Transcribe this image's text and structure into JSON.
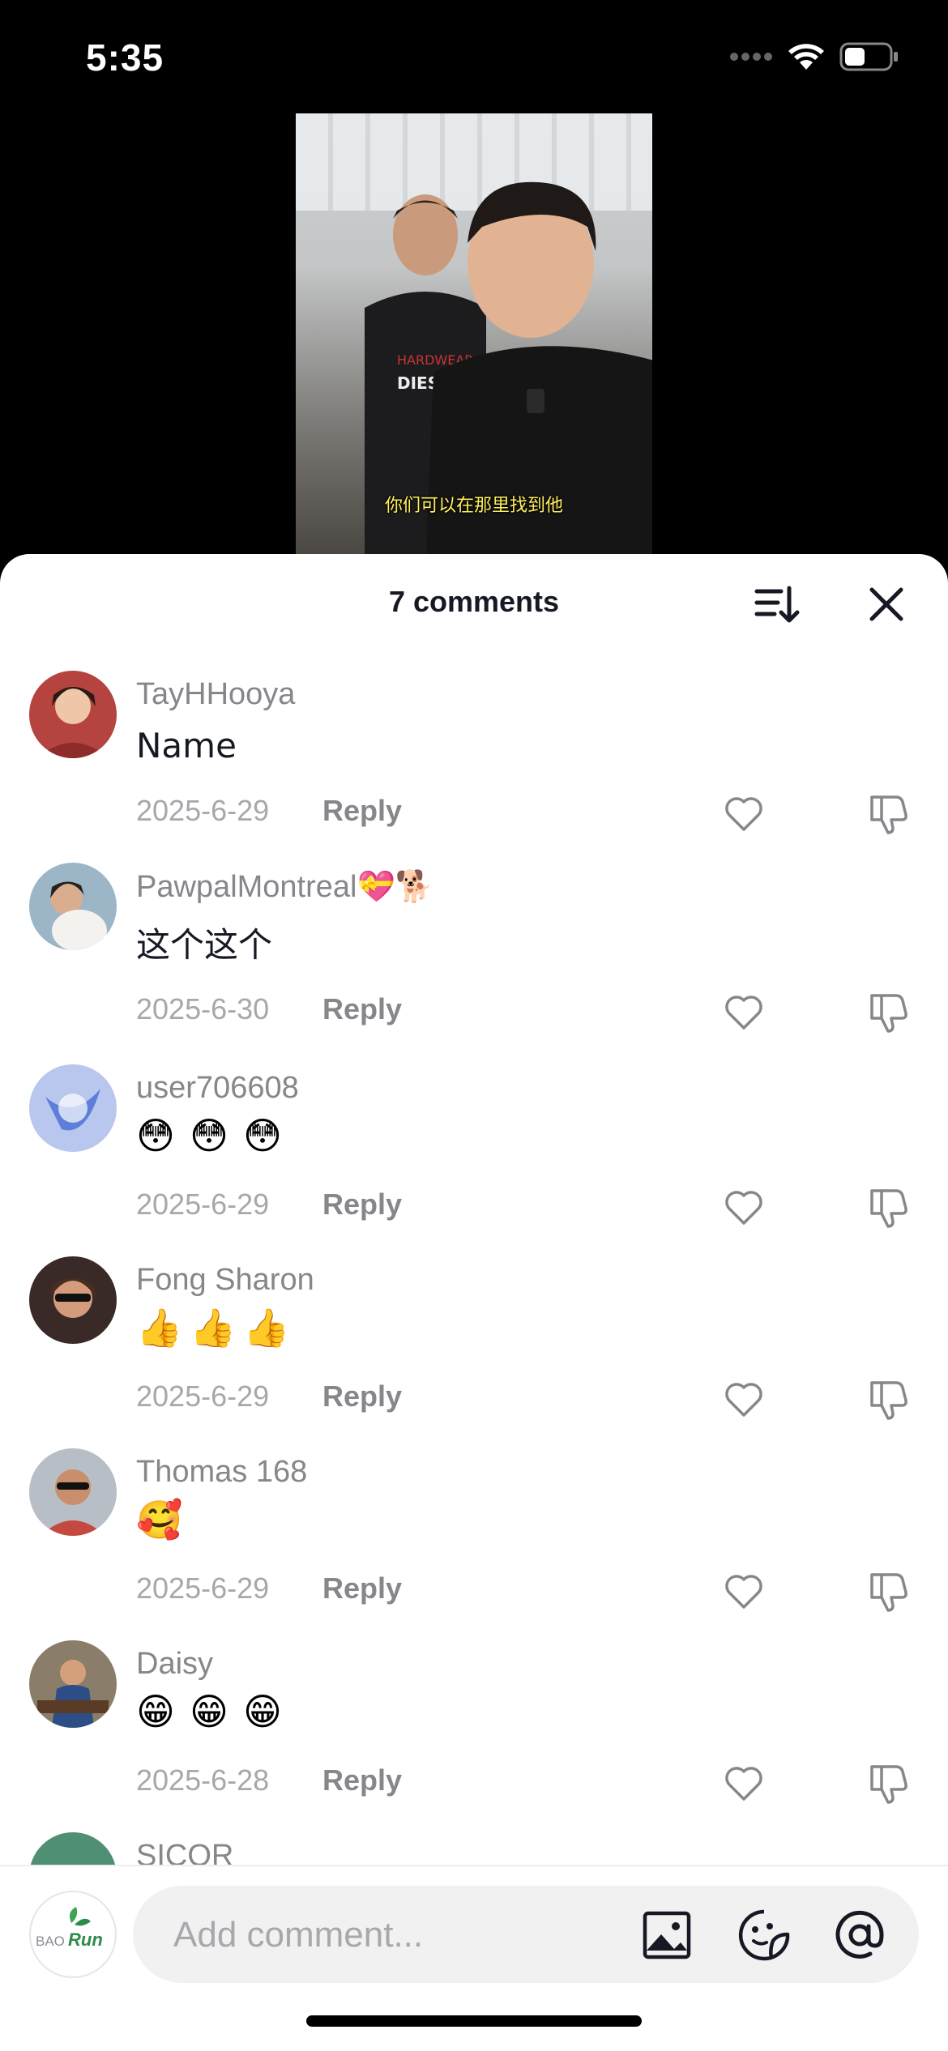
{
  "status_bar": {
    "time": "5:35",
    "icons": [
      "signal-dots-icon",
      "wifi-icon",
      "battery-icon"
    ]
  },
  "video": {
    "subtitle": "你们可以在那里找到他",
    "shirt_text_1": "HARDWEAR",
    "shirt_text_2": "DIESEL"
  },
  "sheet": {
    "title": "7 comments",
    "sort_icon": "sort-icon",
    "close_icon": "close-icon"
  },
  "comments": [
    {
      "username": "TayHHooya",
      "text": "Name",
      "date": "2025-6-29",
      "reply": "Reply",
      "avatar_color": "#b5433f"
    },
    {
      "username": "PawpalMontreal💝🐕",
      "text": "这个这个",
      "date": "2025-6-30",
      "reply": "Reply",
      "avatar_color": "#9db6c7"
    },
    {
      "username": "user706608",
      "emojis": [
        "😳",
        "😳",
        "😳"
      ],
      "date": "2025-6-29",
      "reply": "Reply",
      "avatar_color": "#6f86d6"
    },
    {
      "username": "Fong Sharon",
      "emojis": [
        "👍",
        "👍",
        "👍"
      ],
      "date": "2025-6-29",
      "reply": "Reply",
      "avatar_color": "#3a2a27"
    },
    {
      "username": "Thomas 168",
      "emojis": [
        "🥰"
      ],
      "date": "2025-6-29",
      "reply": "Reply",
      "avatar_color": "#c44a40"
    },
    {
      "username": "Daisy",
      "emojis": [
        "😁",
        "😁",
        "😁"
      ],
      "date": "2025-6-28",
      "reply": "Reply",
      "avatar_color": "#4a5e74"
    },
    {
      "username": "SICOR",
      "date": "",
      "reply": "",
      "avatar_color": "#4f8f73"
    }
  ],
  "composer": {
    "placeholder": "Add comment...",
    "avatar_brand_1": "BAO",
    "avatar_brand_2": "Run",
    "icons": [
      "image-icon",
      "sticker-icon",
      "mention-icon"
    ]
  },
  "colors": {
    "primary_text": "#161823",
    "secondary_text": "#86878b",
    "muted_text": "#a7a8ac",
    "subtitle": "#ffef5a"
  }
}
